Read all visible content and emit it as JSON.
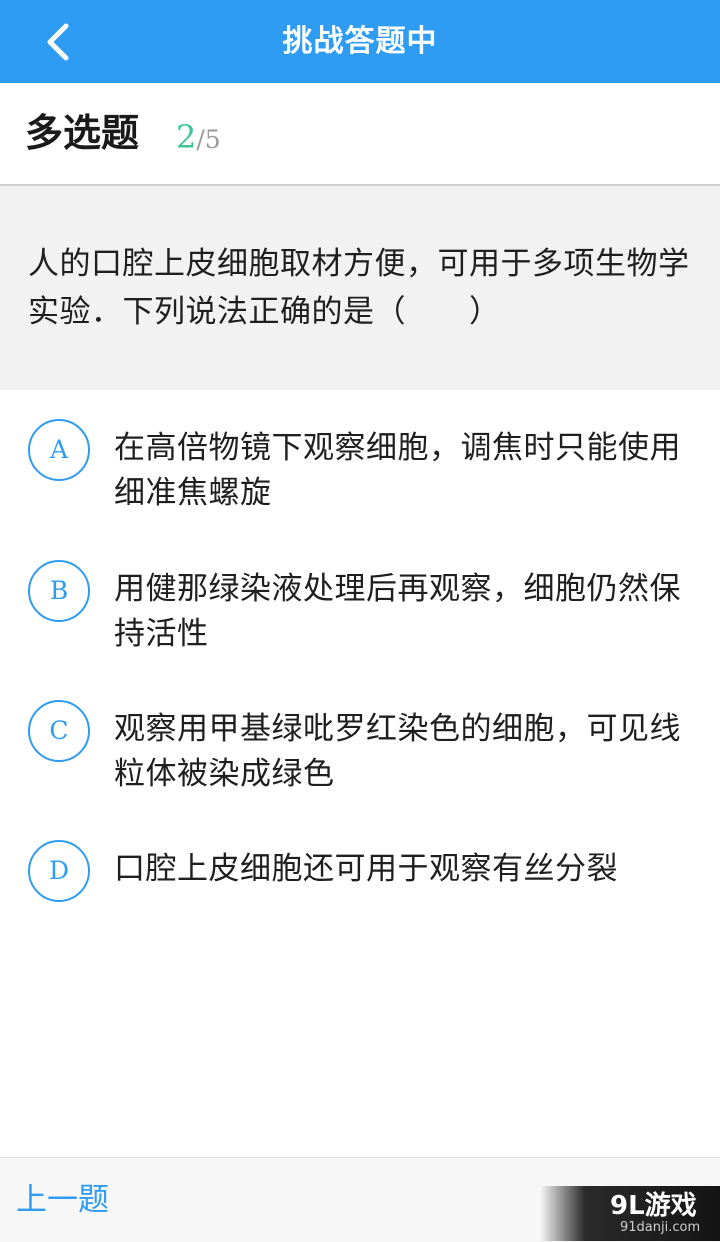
{
  "header": {
    "title": "挑战答题中",
    "back_icon": "chevron-left-icon"
  },
  "question_info": {
    "type": "多选题",
    "current": "2",
    "separator": "/",
    "total": "5"
  },
  "question": {
    "text": "人的口腔上皮细胞取材方便，可用于多项生物学实验．下列说法正确的是（　　）"
  },
  "options": [
    {
      "letter": "A",
      "text": "在高倍物镜下观察细胞，调焦时只能使用细准焦螺旋"
    },
    {
      "letter": "B",
      "text": "用健那绿染液处理后再观察，细胞仍然保持活性"
    },
    {
      "letter": "C",
      "text": "观察用甲基绿吡罗红染色的细胞，可见线粒体被染成绿色"
    },
    {
      "letter": "D",
      "text": "口腔上皮细胞还可用于观察有丝分裂"
    }
  ],
  "footer": {
    "prev_label": "上一题"
  },
  "watermark": {
    "logo": "9L游戏",
    "site": "91danji.com"
  },
  "colors": {
    "primary": "#2e9cf3",
    "progress_current": "#3fc49a",
    "question_bg": "#f2f2f2"
  }
}
